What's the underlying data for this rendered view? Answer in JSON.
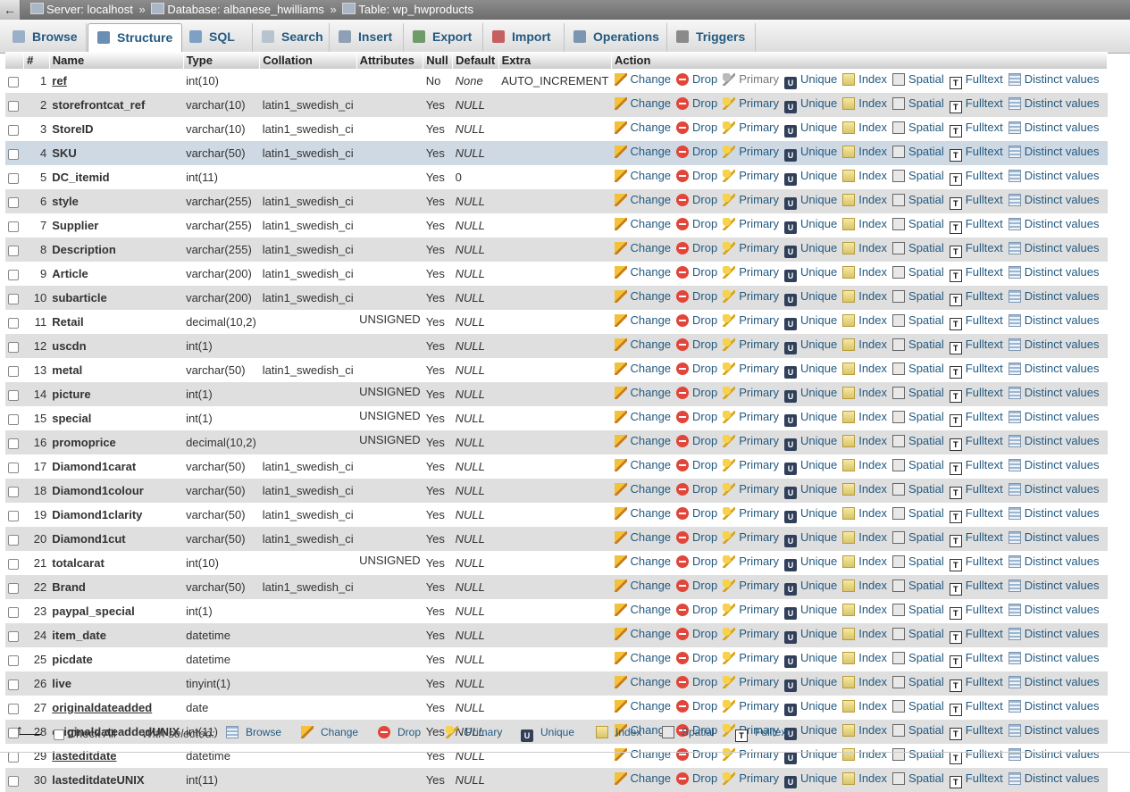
{
  "breadcrumb": {
    "server": "Server: localhost",
    "database": "Database: albanese_hwilliams",
    "table": "Table: wp_hwproducts",
    "separator": "»"
  },
  "tabs": [
    {
      "label": "Browse",
      "icon": "browse-icon"
    },
    {
      "label": "Structure",
      "icon": "structure-icon",
      "active": true
    },
    {
      "label": "SQL",
      "icon": "sql-icon"
    },
    {
      "label": "Search",
      "icon": "search-icon"
    },
    {
      "label": "Insert",
      "icon": "insert-icon"
    },
    {
      "label": "Export",
      "icon": "export-icon"
    },
    {
      "label": "Import",
      "icon": "import-icon"
    },
    {
      "label": "Operations",
      "icon": "operations-icon"
    },
    {
      "label": "Triggers",
      "icon": "triggers-icon"
    }
  ],
  "columns": {
    "num": "#",
    "name": "Name",
    "type": "Type",
    "collation": "Collation",
    "attributes": "Attributes",
    "null": "Null",
    "default": "Default",
    "extra": "Extra",
    "action": "Action"
  },
  "actions": {
    "change": "Change",
    "drop": "Drop",
    "primary": "Primary",
    "unique": "Unique",
    "index": "Index",
    "spatial": "Spatial",
    "fulltext": "Fulltext",
    "distinct": "Distinct values"
  },
  "rows": [
    {
      "num": "1",
      "name": "ref",
      "type": "int(10)",
      "collation": "",
      "attributes": "",
      "null": "No",
      "default": "None",
      "extra": "AUTO_INCREMENT",
      "underline": true
    },
    {
      "num": "2",
      "name": "storefrontcat_ref",
      "type": "varchar(10)",
      "collation": "latin1_swedish_ci",
      "attributes": "",
      "null": "Yes",
      "default": "NULL",
      "extra": ""
    },
    {
      "num": "3",
      "name": "StoreID",
      "type": "varchar(10)",
      "collation": "latin1_swedish_ci",
      "attributes": "",
      "null": "Yes",
      "default": "NULL",
      "extra": ""
    },
    {
      "num": "4",
      "name": "SKU",
      "type": "varchar(50)",
      "collation": "latin1_swedish_ci",
      "attributes": "",
      "null": "Yes",
      "default": "NULL",
      "extra": "",
      "highlight": true
    },
    {
      "num": "5",
      "name": "DC_itemid",
      "type": "int(11)",
      "collation": "",
      "attributes": "",
      "null": "Yes",
      "default": "0",
      "extra": ""
    },
    {
      "num": "6",
      "name": "style",
      "type": "varchar(255)",
      "collation": "latin1_swedish_ci",
      "attributes": "",
      "null": "Yes",
      "default": "NULL",
      "extra": ""
    },
    {
      "num": "7",
      "name": "Supplier",
      "type": "varchar(255)",
      "collation": "latin1_swedish_ci",
      "attributes": "",
      "null": "Yes",
      "default": "NULL",
      "extra": ""
    },
    {
      "num": "8",
      "name": "Description",
      "type": "varchar(255)",
      "collation": "latin1_swedish_ci",
      "attributes": "",
      "null": "Yes",
      "default": "NULL",
      "extra": ""
    },
    {
      "num": "9",
      "name": "Article",
      "type": "varchar(200)",
      "collation": "latin1_swedish_ci",
      "attributes": "",
      "null": "Yes",
      "default": "NULL",
      "extra": ""
    },
    {
      "num": "10",
      "name": "subarticle",
      "type": "varchar(200)",
      "collation": "latin1_swedish_ci",
      "attributes": "",
      "null": "Yes",
      "default": "NULL",
      "extra": ""
    },
    {
      "num": "11",
      "name": "Retail",
      "type": "decimal(10,2)",
      "collation": "",
      "attributes": "UNSIGNED",
      "null": "Yes",
      "default": "NULL",
      "extra": ""
    },
    {
      "num": "12",
      "name": "uscdn",
      "type": "int(1)",
      "collation": "",
      "attributes": "",
      "null": "Yes",
      "default": "NULL",
      "extra": ""
    },
    {
      "num": "13",
      "name": "metal",
      "type": "varchar(50)",
      "collation": "latin1_swedish_ci",
      "attributes": "",
      "null": "Yes",
      "default": "NULL",
      "extra": ""
    },
    {
      "num": "14",
      "name": "picture",
      "type": "int(1)",
      "collation": "",
      "attributes": "UNSIGNED",
      "null": "Yes",
      "default": "NULL",
      "extra": ""
    },
    {
      "num": "15",
      "name": "special",
      "type": "int(1)",
      "collation": "",
      "attributes": "UNSIGNED",
      "null": "Yes",
      "default": "NULL",
      "extra": ""
    },
    {
      "num": "16",
      "name": "promoprice",
      "type": "decimal(10,2)",
      "collation": "",
      "attributes": "UNSIGNED",
      "null": "Yes",
      "default": "NULL",
      "extra": ""
    },
    {
      "num": "17",
      "name": "Diamond1carat",
      "type": "varchar(50)",
      "collation": "latin1_swedish_ci",
      "attributes": "",
      "null": "Yes",
      "default": "NULL",
      "extra": ""
    },
    {
      "num": "18",
      "name": "Diamond1colour",
      "type": "varchar(50)",
      "collation": "latin1_swedish_ci",
      "attributes": "",
      "null": "Yes",
      "default": "NULL",
      "extra": ""
    },
    {
      "num": "19",
      "name": "Diamond1clarity",
      "type": "varchar(50)",
      "collation": "latin1_swedish_ci",
      "attributes": "",
      "null": "Yes",
      "default": "NULL",
      "extra": ""
    },
    {
      "num": "20",
      "name": "Diamond1cut",
      "type": "varchar(50)",
      "collation": "latin1_swedish_ci",
      "attributes": "",
      "null": "Yes",
      "default": "NULL",
      "extra": ""
    },
    {
      "num": "21",
      "name": "totalcarat",
      "type": "int(10)",
      "collation": "",
      "attributes": "UNSIGNED",
      "null": "Yes",
      "default": "NULL",
      "extra": ""
    },
    {
      "num": "22",
      "name": "Brand",
      "type": "varchar(50)",
      "collation": "latin1_swedish_ci",
      "attributes": "",
      "null": "Yes",
      "default": "NULL",
      "extra": ""
    },
    {
      "num": "23",
      "name": "paypal_special",
      "type": "int(1)",
      "collation": "",
      "attributes": "",
      "null": "Yes",
      "default": "NULL",
      "extra": ""
    },
    {
      "num": "24",
      "name": "item_date",
      "type": "datetime",
      "collation": "",
      "attributes": "",
      "null": "Yes",
      "default": "NULL",
      "extra": ""
    },
    {
      "num": "25",
      "name": "picdate",
      "type": "datetime",
      "collation": "",
      "attributes": "",
      "null": "Yes",
      "default": "NULL",
      "extra": ""
    },
    {
      "num": "26",
      "name": "live",
      "type": "tinyint(1)",
      "collation": "",
      "attributes": "",
      "null": "Yes",
      "default": "NULL",
      "extra": ""
    },
    {
      "num": "27",
      "name": "originaldateadded",
      "type": "date",
      "collation": "",
      "attributes": "",
      "null": "Yes",
      "default": "NULL",
      "extra": "",
      "underline": true
    },
    {
      "num": "28",
      "name": "originaldateaddedUNIX",
      "type": "int(11)",
      "collation": "",
      "attributes": "",
      "null": "Yes",
      "default": "NULL",
      "extra": ""
    },
    {
      "num": "29",
      "name": "lasteditdate",
      "type": "datetime",
      "collation": "",
      "attributes": "",
      "null": "Yes",
      "default": "NULL",
      "extra": "",
      "underline": true
    },
    {
      "num": "30",
      "name": "lasteditdateUNIX",
      "type": "int(11)",
      "collation": "",
      "attributes": "",
      "null": "Yes",
      "default": "NULL",
      "extra": ""
    }
  ],
  "footer": {
    "check_all": "Check All",
    "with_selected": "With selected:",
    "actions": [
      "Browse",
      "Change",
      "Drop",
      "Primary",
      "Unique",
      "Index",
      "Spatial",
      "Fulltext"
    ]
  }
}
